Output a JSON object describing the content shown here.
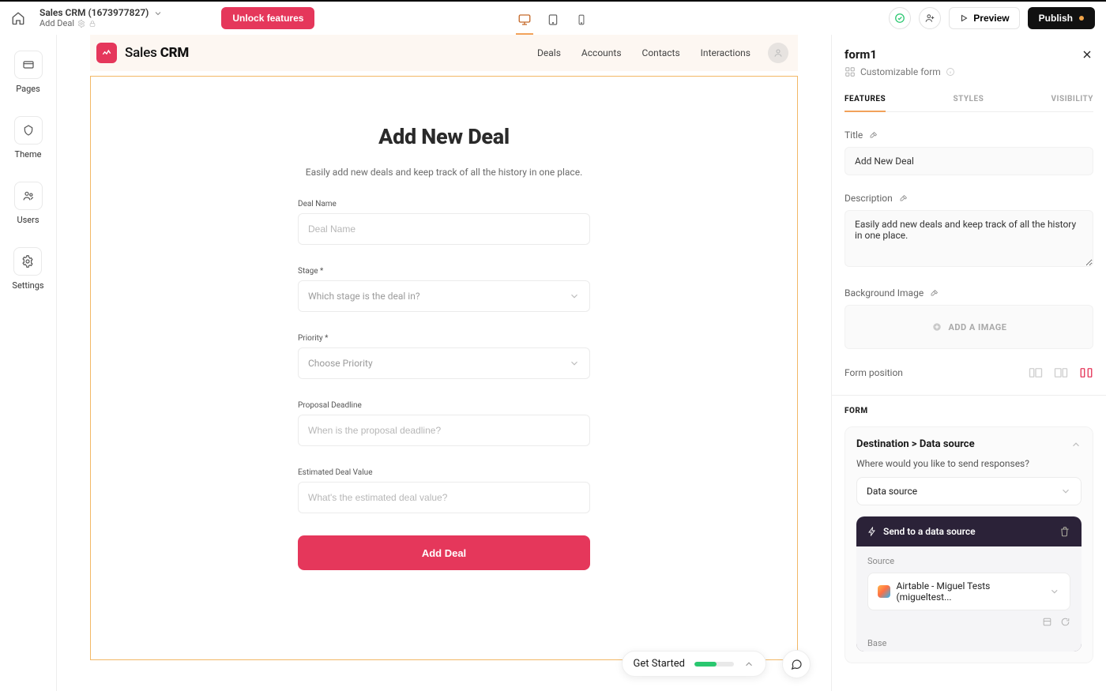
{
  "header": {
    "project_name": "Sales CRM (1673977827)",
    "page_name": "Add Deal",
    "unlock_label": "Unlock features",
    "preview_label": "Preview",
    "publish_label": "Publish"
  },
  "rail": {
    "pages": "Pages",
    "theme": "Theme",
    "users": "Users",
    "settings": "Settings"
  },
  "preview_app": {
    "brand_light": "Sales",
    "brand_bold": "CRM",
    "nav": {
      "deals": "Deals",
      "accounts": "Accounts",
      "contacts": "Contacts",
      "interactions": "Interactions"
    },
    "form": {
      "title": "Add New Deal",
      "description": "Easily add new deals and keep track of all the history in one place.",
      "fields": {
        "deal_name": {
          "label": "Deal Name",
          "placeholder": "Deal Name"
        },
        "stage": {
          "label": "Stage *",
          "placeholder": "Which stage is the deal in?"
        },
        "priority": {
          "label": "Priority *",
          "placeholder": "Choose Priority"
        },
        "deadline": {
          "label": "Proposal Deadline",
          "placeholder": "When is the proposal deadline?"
        },
        "value": {
          "label": "Estimated Deal Value",
          "placeholder": "What's the estimated deal value?"
        }
      },
      "submit": "Add Deal"
    }
  },
  "inspector": {
    "element_name": "form1",
    "subtitle": "Customizable form",
    "tabs": {
      "features": "FEATURES",
      "styles": "STYLES",
      "visibility": "VISIBILITY"
    },
    "title_label": "Title",
    "title_value": "Add New Deal",
    "desc_label": "Description",
    "desc_value": "Easily add new deals and keep track of all the history in one place.",
    "bg_label": "Background Image",
    "add_image": "ADD A IMAGE",
    "form_position": "Form position",
    "form_section": "FORM",
    "dest_heading": "Destination > Data source",
    "dest_q": "Where would you like to send responses?",
    "dest_select": "Data source",
    "send_title": "Send to a data source",
    "src_label": "Source",
    "src_value": "Airtable - Miguel Tests (migueltest...",
    "base_label": "Base"
  },
  "getstarted": {
    "label": "Get Started"
  }
}
